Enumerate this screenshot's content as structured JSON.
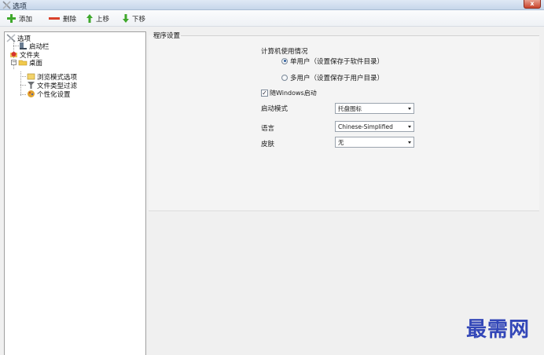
{
  "window": {
    "title": "选项",
    "close_glyph": "x"
  },
  "toolbar": {
    "add_label": "添加",
    "delete_label": "删除",
    "move_up_label": "上移",
    "move_down_label": "下移"
  },
  "tree": {
    "root": {
      "label": "选项",
      "icon": "options-icon"
    },
    "items": [
      {
        "label": "启动栏",
        "icon": "taskbar-icon"
      },
      {
        "label": "文件夹",
        "icon": "folder-heart-icon"
      },
      {
        "label": "桌面",
        "icon": "folder-open-icon"
      },
      {
        "label": "浏览模式选项",
        "icon": "browse-mode-icon"
      },
      {
        "label": "文件类型过滤",
        "icon": "filter-icon"
      },
      {
        "label": "个性化设置",
        "icon": "personalize-icon"
      }
    ]
  },
  "settings": {
    "group_title": "程序设置",
    "usage_label": "计算机使用情况",
    "radio_single": "单用户（设置保存于软件目录）",
    "radio_multi": "多用户（设置保存于用户目录）",
    "selected_radio": "single",
    "startup_checkbox": "随Windows启动",
    "startup_checked": true,
    "startup_mode_label": "启动模式",
    "startup_mode_value": "托盘图标",
    "language_label": "语言",
    "language_value": "Chinese-Simplified",
    "skin_label": "皮肤",
    "skin_value": "无"
  },
  "watermark": "最需网",
  "colors": {
    "accent": "#2f5e9c",
    "watermark": "#3347b8",
    "close": "#c9432b"
  }
}
